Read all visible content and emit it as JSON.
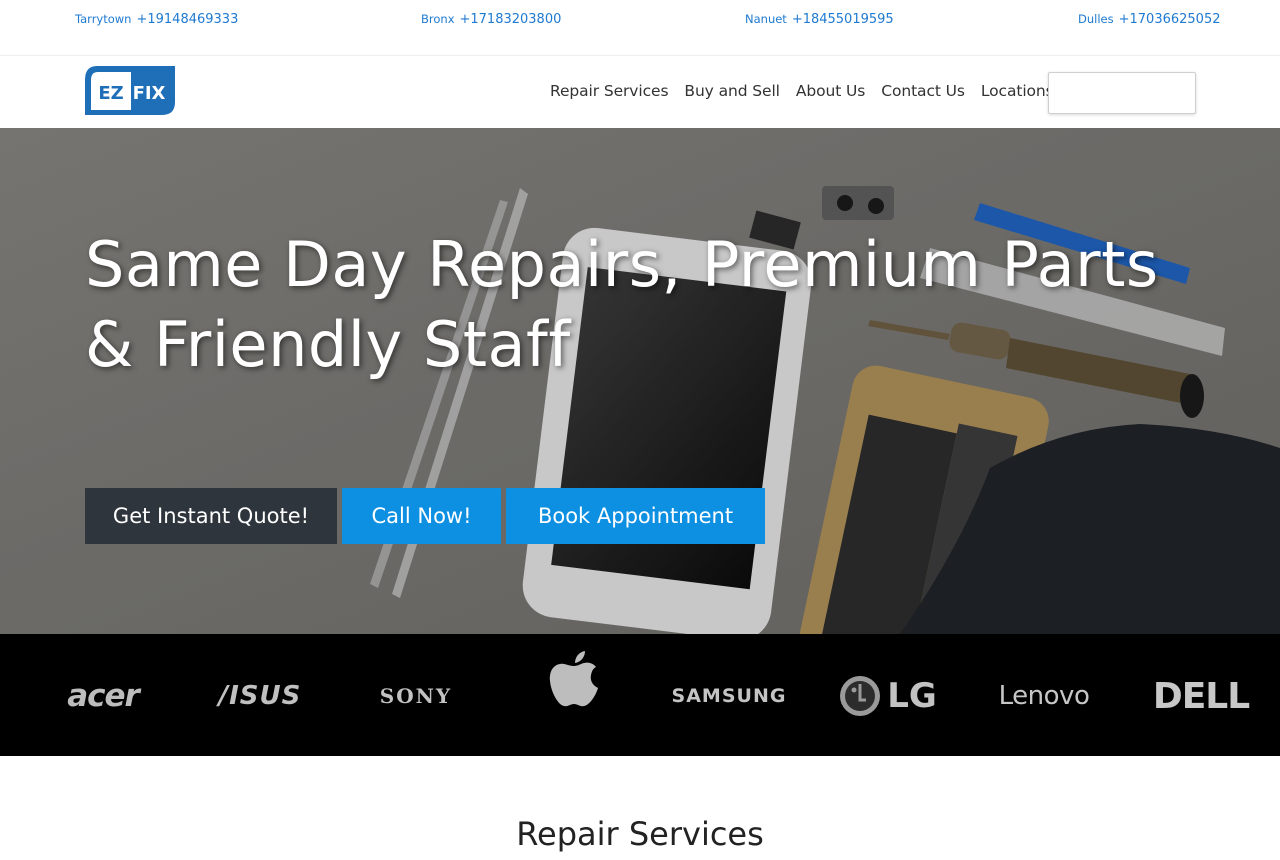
{
  "locations": [
    {
      "city": "Tarrytown",
      "phone": "+19148469333"
    },
    {
      "city": "Bronx",
      "phone": "+17183203800"
    },
    {
      "city": "Nanuet",
      "phone": "+18455019595"
    },
    {
      "city": "Dulles",
      "phone": "+17036625052"
    }
  ],
  "logo": {
    "left_text": "EZ",
    "right_text": "FIX"
  },
  "nav": {
    "items": [
      "Repair Services",
      "Buy and Sell",
      "About Us",
      "Contact Us",
      "Locations"
    ],
    "search_value": ""
  },
  "hero": {
    "title": "Same Day Repairs, Premium Parts & Friendly Staff",
    "buttons": {
      "quote": "Get Instant Quote!",
      "call": "Call Now!",
      "book": "Book Appointment"
    }
  },
  "brands": [
    "acer",
    "/ISUS",
    "SONY",
    "apple",
    "SAMSUNG",
    "LG",
    "Lenovo",
    "DELL"
  ],
  "sections": {
    "repair_title": "Repair Services"
  },
  "colors": {
    "accent": "#0d8fe2",
    "link": "#1f7ad1",
    "dark_button": "#2f353c",
    "brand_strip": "#000000"
  }
}
